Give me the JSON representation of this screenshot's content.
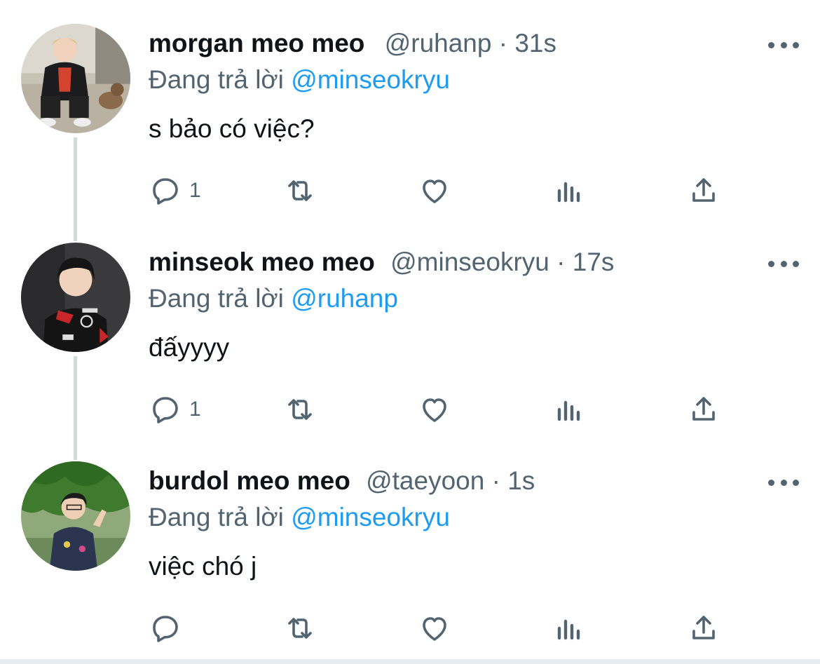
{
  "colors": {
    "accent": "#1d9bf0",
    "secondary_text": "#536471",
    "primary_text": "#0f1419",
    "thread_line": "#cfd9de"
  },
  "tweets": [
    {
      "name": "morgan meo meo",
      "handle": "@ruhanp",
      "dot": "·",
      "time": "31s",
      "reply_prefix": "Đang trả lời",
      "reply_to": "@minseokryu",
      "text": "s bảo có việc?",
      "reply_count": "1",
      "avatar_icon": "avatar-photo-crouching-with-dog"
    },
    {
      "name": "minseok meo meo",
      "handle": "@minseokryu",
      "dot": "·",
      "time": "17s",
      "reply_prefix": "Đang trả lời",
      "reply_to": "@ruhanp",
      "text": "đấyyyy",
      "reply_count": "1",
      "avatar_icon": "avatar-photo-team-jersey"
    },
    {
      "name": "burdol meo meo",
      "handle": "@taeyoon",
      "dot": "·",
      "time": "1s",
      "reply_prefix": "Đang trả lời",
      "reply_to": "@minseokryu",
      "text": "việc chó j",
      "reply_count": "",
      "avatar_icon": "avatar-photo-under-tree"
    }
  ],
  "action_icons": [
    "reply-icon",
    "retweet-icon",
    "like-icon",
    "views-icon",
    "share-icon"
  ],
  "more_icon": "more-options-icon"
}
